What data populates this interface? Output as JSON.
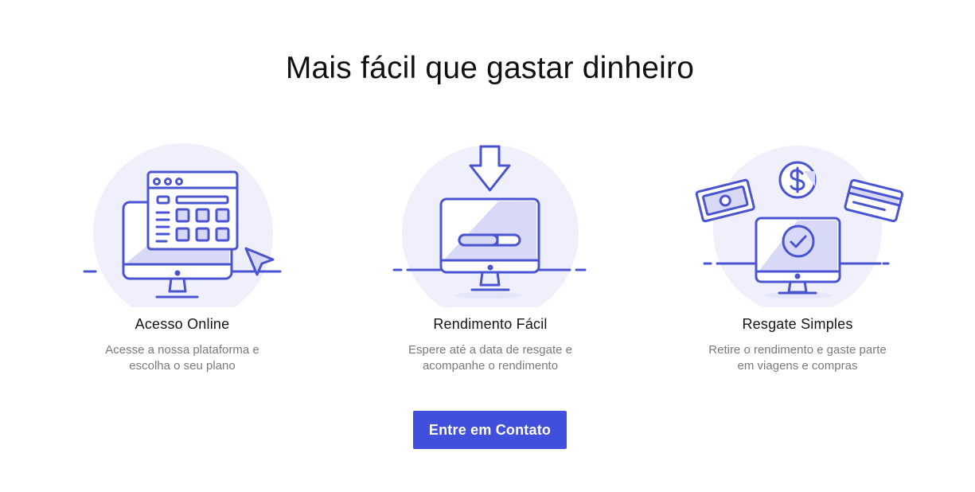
{
  "title": "Mais fácil que gastar dinheiro",
  "colors": {
    "accent": "#4050dd",
    "illustration_stroke": "#4a53d0",
    "illustration_bg": "#eff0fc",
    "illustration_fill": "#d7d9f7",
    "description_text": "#7a7a7a"
  },
  "features": [
    {
      "icon": "online-access-icon",
      "title": "Acesso Online",
      "description": [
        "Acesse a nossa plataforma e",
        "escolha o seu plano"
      ]
    },
    {
      "icon": "easy-yield-icon",
      "title": "Rendimento Fácil",
      "description": [
        "Espere até a data de resgate e",
        "acompanhe o rendimento"
      ]
    },
    {
      "icon": "simple-withdrawal-icon",
      "title": "Resgate Simples",
      "description": [
        "Retire o rendimento e gaste parte",
        "em viagens e compras"
      ]
    }
  ],
  "cta": {
    "label": "Entre em Contato"
  }
}
